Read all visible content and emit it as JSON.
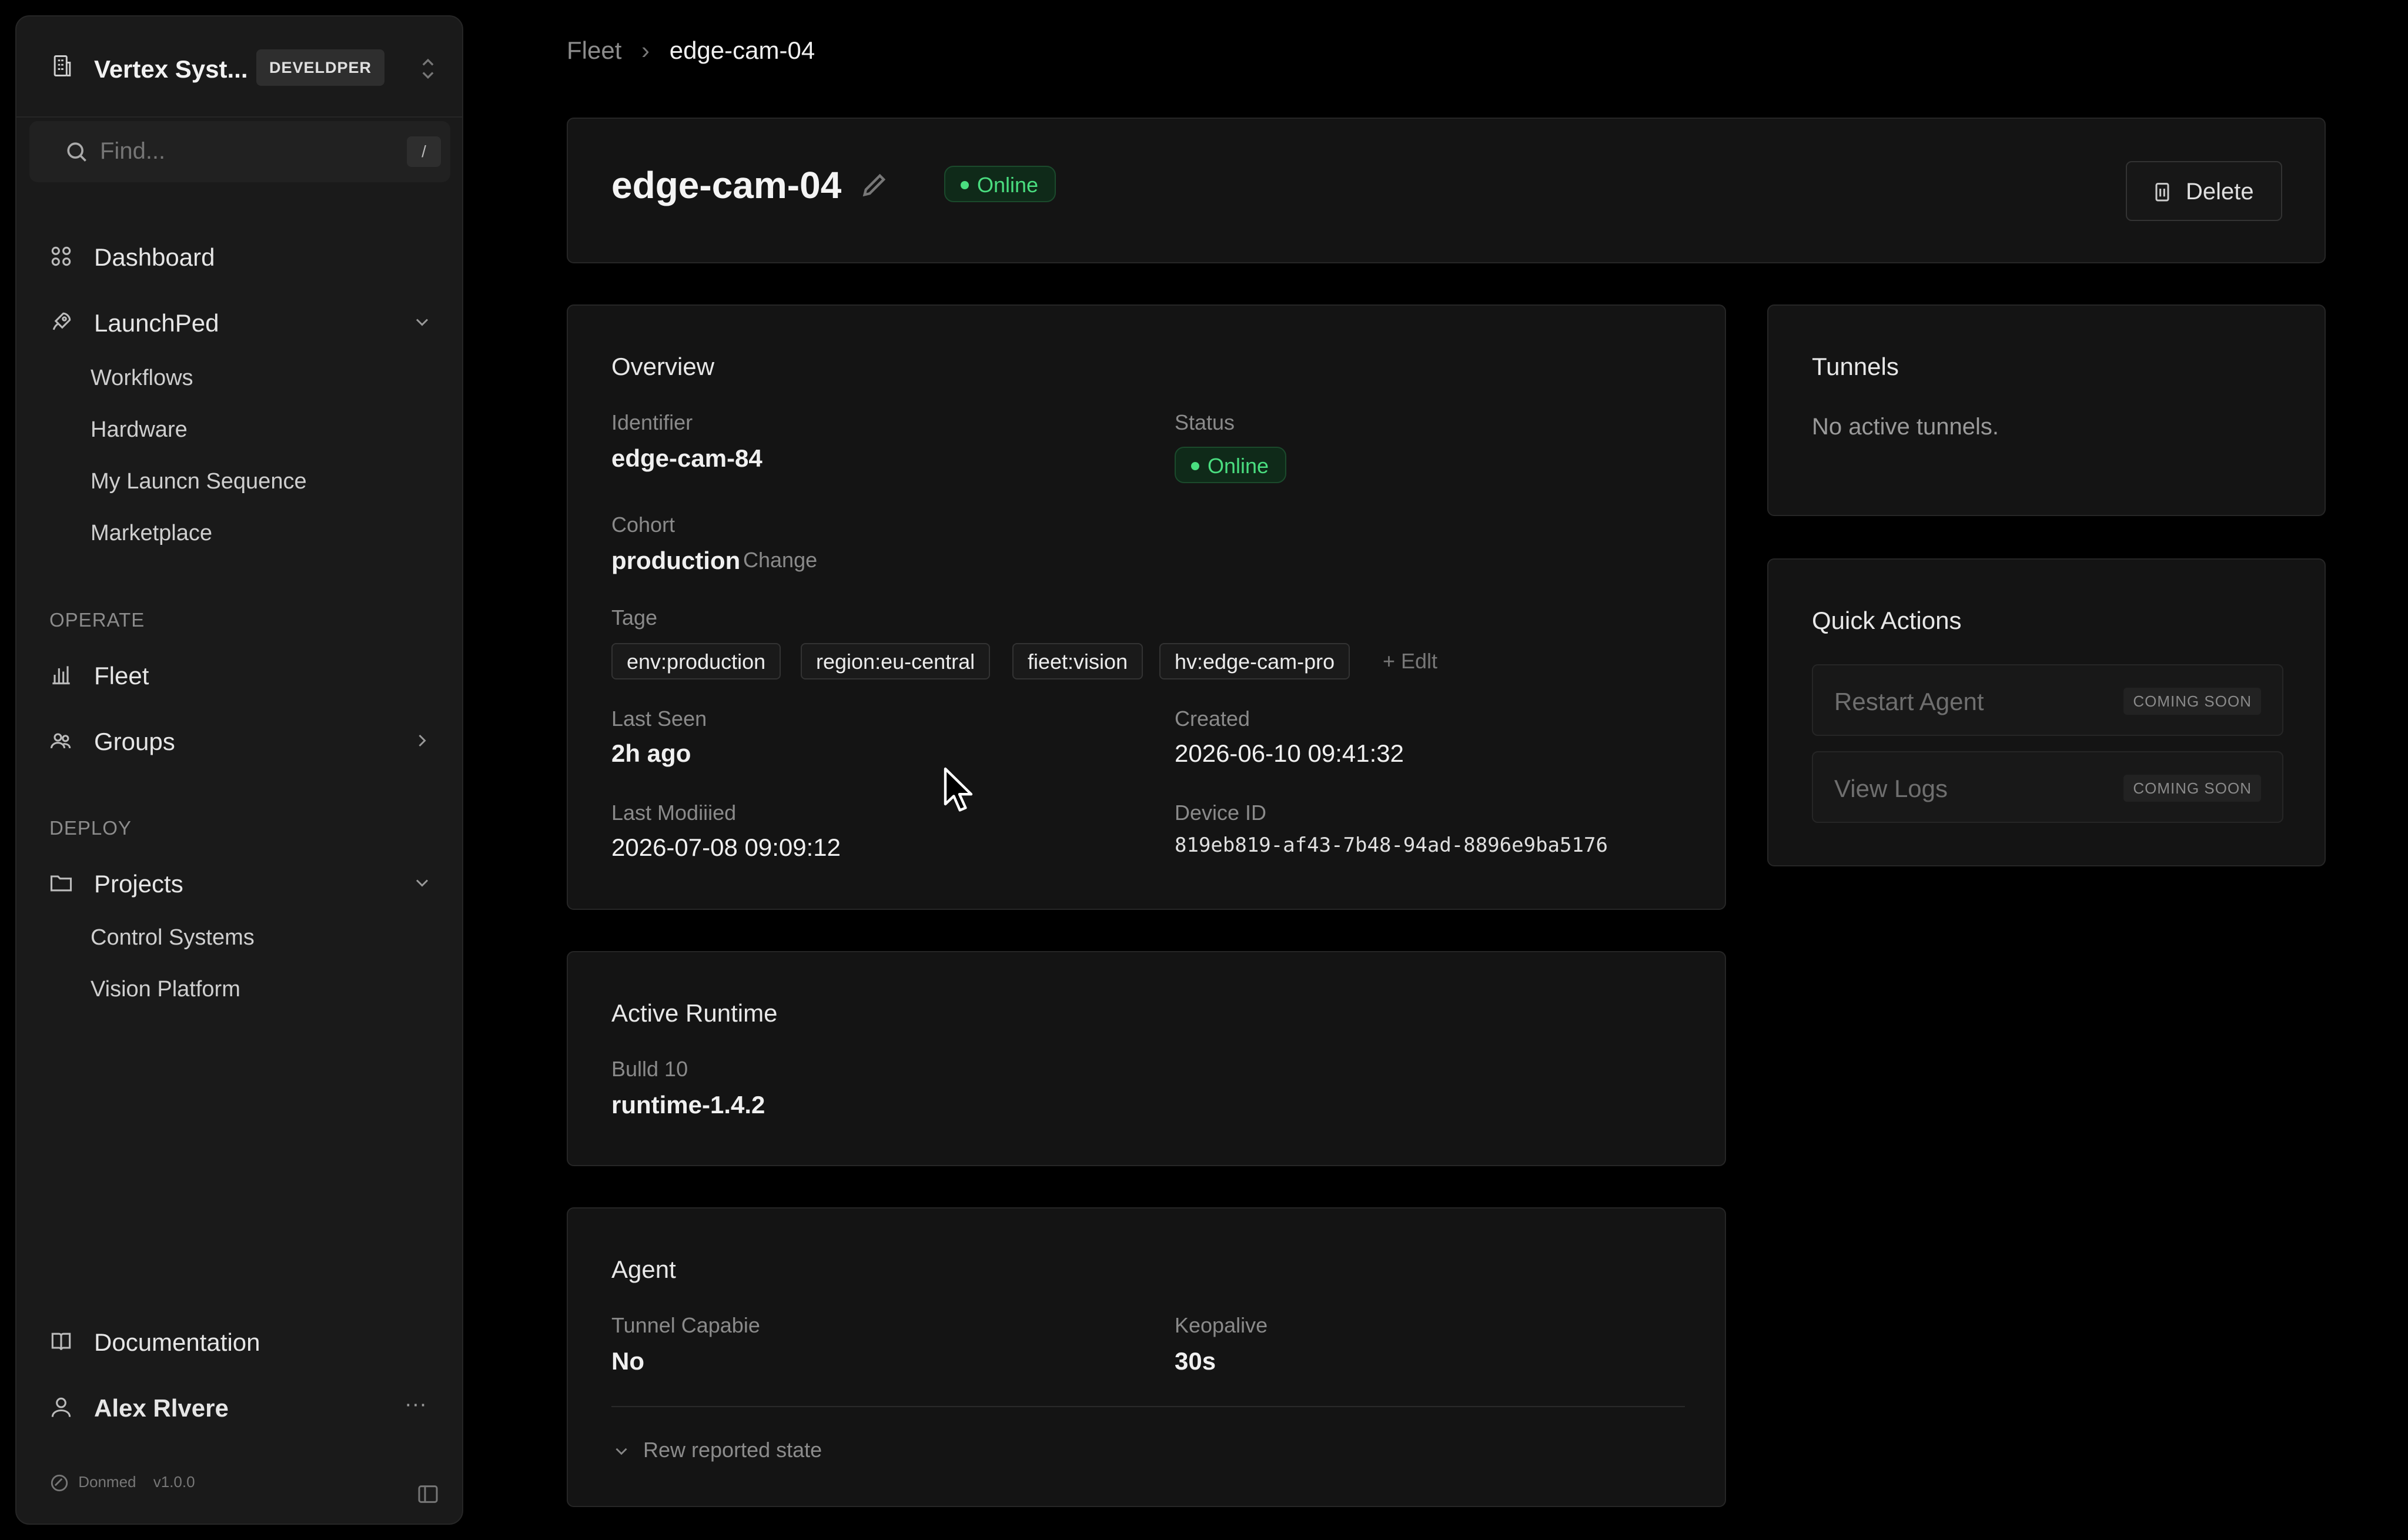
{
  "sidebar": {
    "org_name": "Vertex Syst...",
    "env_badge": "DEVELDPER",
    "search_placeholder": "Find...",
    "search_shortcut": "/",
    "nav": {
      "dashboard": "Dashboard",
      "launchpad": "LaunchPed",
      "launchpad_items": [
        "Workflows",
        "Hardware",
        "My Launcn Sequence",
        "Marketplace"
      ],
      "operate_label": "OPERATE",
      "fleet": "Fleet",
      "groups": "Groups",
      "deploy_label": "DEPLOY",
      "projects": "Projects",
      "projects_items": [
        "Control Systems",
        "Vision Platform"
      ],
      "documentation": "Documentation",
      "user": "Alex Rlvere",
      "user_more": "···"
    },
    "footer": {
      "brand": "Donmed",
      "version": "v1.0.0"
    }
  },
  "breadcrumb": {
    "parent": "Fleet",
    "current": "edge-cam-04"
  },
  "device": {
    "title": "edge-cam-04",
    "status": "Online",
    "delete_label": "Delete"
  },
  "overview": {
    "title": "Overview",
    "identifier_label": "Identifier",
    "identifier": "edge-cam-84",
    "status_label": "Status",
    "status": "Online",
    "cohort_label": "Cohort",
    "cohort": "production",
    "change_label": "Change",
    "tags_label": "Tage",
    "tags": [
      "env:production",
      "region:eu-central",
      "fieet:vision",
      "hv:edge-cam-pro"
    ],
    "edit_label": "+ Edlt",
    "last_seen_label": "Last Seen",
    "last_seen": "2h ago",
    "created_label": "Created",
    "created": "2026-06-10 09:41:32",
    "last_modified_label": "Last Modiiied",
    "last_modified": "2026-07-08 09:09:12",
    "device_id_label": "Device ID",
    "device_id": "819eb819-af43-7b48-94ad-8896e9ba5176"
  },
  "runtime": {
    "title": "Active Runtime",
    "build_label": "Bulld 10",
    "build": "runtime-1.4.2"
  },
  "agent": {
    "title": "Agent",
    "tunnel_label": "Tunnel Capabie",
    "tunnel": "No",
    "keepalive_label": "Keopalive",
    "keepalive": "30s",
    "raw_toggle": "Rew reported state"
  },
  "tunnels": {
    "title": "Tunnels",
    "empty": "No active tunnels."
  },
  "quick_actions": {
    "title": "Quick Actions",
    "restart": "Restart Agent",
    "logs": "View Logs",
    "soon": "COMING SOON"
  },
  "colors": {
    "background": "#000000",
    "panel": "#141414",
    "sidebar": "#1a1a1a",
    "online_green": "#4ade80"
  }
}
